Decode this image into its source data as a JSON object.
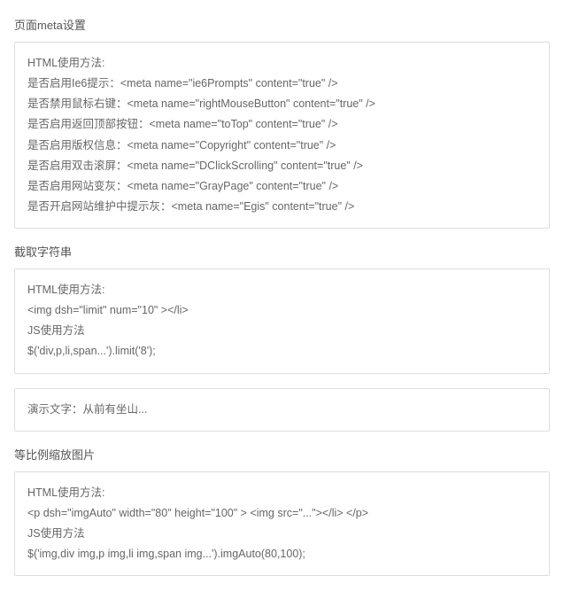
{
  "sections": [
    {
      "title": "页面meta设置",
      "blocks": [
        {
          "lines": [
            "HTML使用方法:",
            "是否启用Ie6提示：<meta name=\"ie6Prompts\" content=\"true\" />",
            "是否禁用鼠标右键：<meta name=\"rightMouseButton\" content=\"true\" />",
            "是否启用返回顶部按钮：<meta name=\"toTop\" content=\"true\" />",
            "是否启用版权信息：<meta name=\"Copyright\" content=\"true\" />",
            "是否启用双击滚屏：<meta name=\"DClickScrolling\" content=\"true\" />",
            "是否启用网站变灰：<meta name=\"GrayPage\" content=\"true\" />",
            "是否开启网站维护中提示灰：<meta name=\"Egis\" content=\"true\" />"
          ]
        }
      ]
    },
    {
      "title": "截取字符串",
      "blocks": [
        {
          "lines": [
            "HTML使用方法:",
            "<img dsh=\"limit\" num=\"10\" ></li>",
            "JS使用方法",
            "$('div,p,li,span...').limit('8');"
          ]
        },
        {
          "lines": [
            "演示文字：从前有坐山..."
          ]
        }
      ]
    },
    {
      "title": "等比例缩放图片",
      "blocks": [
        {
          "lines": [
            "HTML使用方法:",
            "<p dsh=\"imgAuto\" width=\"80\" height=\"100\" > <img src=\"...\"></li> </p>",
            "JS使用方法",
            "$('img,div img,p img,li img,span img...').imgAuto(80,100);"
          ]
        }
      ]
    }
  ]
}
